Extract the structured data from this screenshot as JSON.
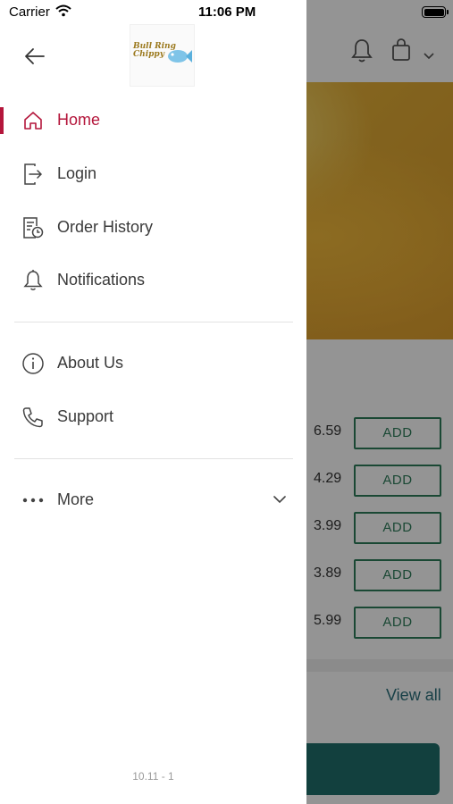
{
  "status_bar": {
    "carrier": "Carrier",
    "time": "11:06 PM"
  },
  "drawer": {
    "menu_items": [
      {
        "label": "Home",
        "icon": "home-icon",
        "active": true
      },
      {
        "label": "Login",
        "icon": "login-icon",
        "active": false
      },
      {
        "label": "Order History",
        "icon": "order-history-icon",
        "active": false
      },
      {
        "label": "Notifications",
        "icon": "bell-icon",
        "active": false
      }
    ],
    "secondary_items": [
      {
        "label": "About Us",
        "icon": "info-icon"
      },
      {
        "label": "Support",
        "icon": "phone-icon"
      }
    ],
    "more": {
      "label": "More"
    },
    "version": "10.11 - 1",
    "logo_text": "Bull Ring Chippy"
  },
  "background": {
    "prices": [
      "6.59",
      "4.29",
      "3.99",
      "3.89",
      "5.99"
    ],
    "add_label": "ADD",
    "view_all": "View all"
  },
  "colors": {
    "accent": "#b4163b",
    "teal": "#1f6e6b",
    "add_green": "#2e7d5b"
  }
}
